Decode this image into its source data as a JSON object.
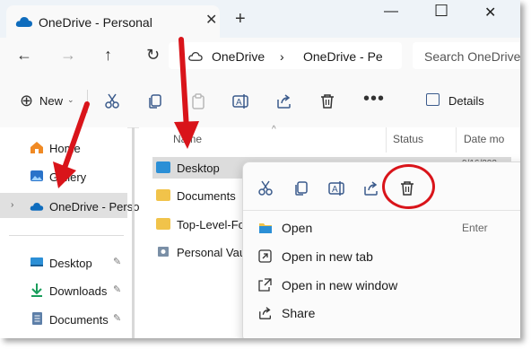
{
  "window": {
    "tab_title": "OneDrive - Personal",
    "close_tab": "✕",
    "new_tab": "+",
    "minimize": "—",
    "maximize": "☐",
    "close": "✕"
  },
  "nav": {
    "back": "←",
    "forward": "→",
    "up": "↑",
    "refresh": "↻",
    "breadcrumb": [
      "OneDrive",
      "OneDrive - Pe"
    ],
    "breadcrumb_sep": "›",
    "search_placeholder": "Search OneDrive"
  },
  "toolbar": {
    "new_label": "New",
    "new_plus": "⊕",
    "new_chev": "⌄",
    "more": "•••",
    "details_label": "Details",
    "icons": [
      "cut-icon",
      "copy-icon",
      "paste-icon",
      "rename-icon",
      "share-icon",
      "delete-icon"
    ]
  },
  "sidebar": {
    "items": [
      {
        "label": "Home",
        "icon": "home-icon"
      },
      {
        "label": "Gallery",
        "icon": "gallery-icon"
      },
      {
        "label": "OneDrive - Personal",
        "icon": "onedrive-icon"
      },
      {
        "label": "Desktop",
        "icon": "desktop-icon"
      },
      {
        "label": "Downloads",
        "icon": "downloads-icon"
      },
      {
        "label": "Documents",
        "icon": "documents-icon"
      }
    ],
    "pin": "📌"
  },
  "columns": {
    "name": "Name",
    "status": "Status",
    "date": "Date mo",
    "sort_indicator": "^"
  },
  "files": [
    {
      "name": "Desktop",
      "date": "9/16/202",
      "icon": "desktop-folder-icon"
    },
    {
      "name": "Documents",
      "date": "",
      "icon": "folder-icon"
    },
    {
      "name": "Top-Level-Folder",
      "date": "",
      "icon": "folder-icon"
    },
    {
      "name": "Personal Vault",
      "date": "",
      "icon": "vault-icon"
    }
  ],
  "context_menu": {
    "quick_actions": [
      "cut-icon",
      "copy-icon",
      "rename-icon",
      "share-icon",
      "delete-icon"
    ],
    "items": [
      {
        "label": "Open",
        "shortcut": "Enter",
        "icon": "open-icon"
      },
      {
        "label": "Open in new tab",
        "shortcut": "",
        "icon": "new-tab-icon"
      },
      {
        "label": "Open in new window",
        "shortcut": "",
        "icon": "new-window-icon"
      },
      {
        "label": "Share",
        "shortcut": "",
        "icon": "share-icon"
      }
    ]
  },
  "colors": {
    "annotation_red": "#d9141a",
    "accent": "#3b5b8c",
    "folder_yellow": "#f1c34a",
    "onedrive_blue": "#0f6cbd"
  }
}
